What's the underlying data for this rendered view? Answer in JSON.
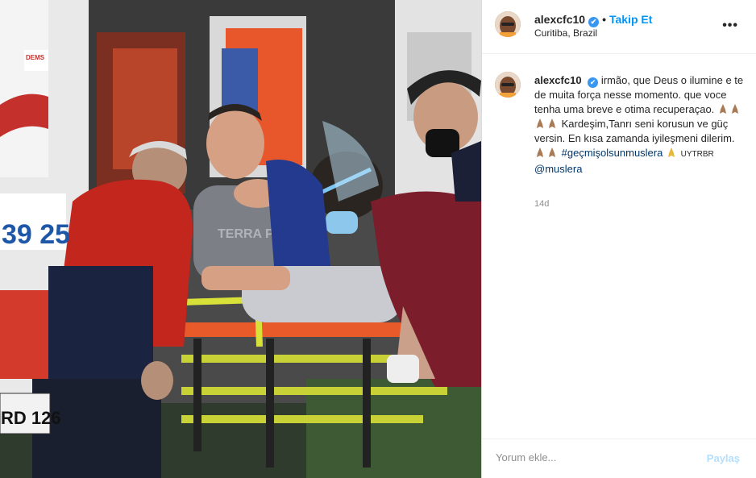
{
  "post": {
    "username": "alexcfc10",
    "verified_badge": "✔",
    "dot": "•",
    "follow_label": "Takip Et",
    "location": "Curitiba, Brazil",
    "more_options": "•••"
  },
  "photo": {
    "ambulance_number": "39 25",
    "plate_text": "RD 126",
    "ambulance_label": "DEMS",
    "jersey_text": "TERRA PAY"
  },
  "caption": {
    "username": "alexcfc10",
    "line1": "irmão, que Deus o ilumine e te de muita força nesse momento. que voce tenha uma breve e otima recuperaçao.",
    "line2": "Kardeşim,Tanrı seni korusun ve güç versin. En kısa zamanda iyileşmeni dilerim.",
    "hashtag": "#geçmişolsunmuslera",
    "small_text": "UYTRBR",
    "mention": "@muslera",
    "time_ago": "14d"
  },
  "comment": {
    "placeholder": "Yorum ekle...",
    "share_label": "Paylaş"
  },
  "colors": {
    "accent": "#0095f6",
    "verified": "#3897f0",
    "share_disabled": "#b2dffc",
    "muted": "#8e8e8e"
  }
}
